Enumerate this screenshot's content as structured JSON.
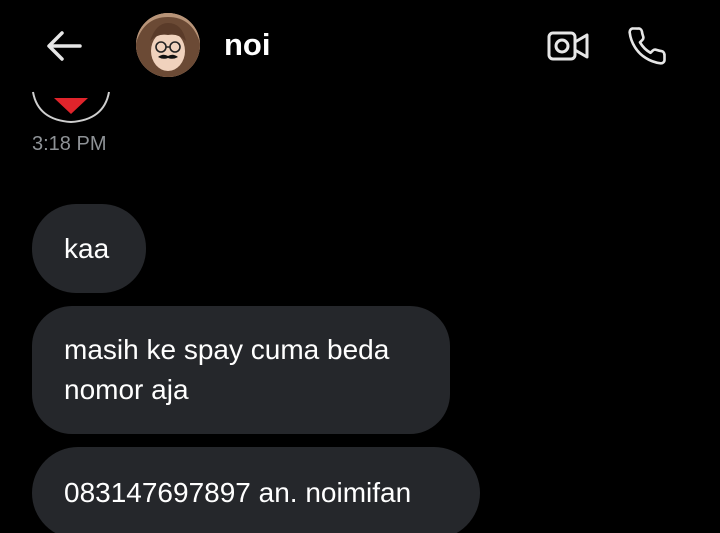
{
  "header": {
    "contact_name": "noi",
    "avatar_alt": "noi profile picture"
  },
  "icons": {
    "back": "arrow-left-icon",
    "video": "video-camera-icon",
    "call": "phone-icon",
    "previous": "heart-reaction-icon"
  },
  "conversation": {
    "timestamp": "3:18 PM",
    "messages": [
      {
        "text": "kaa"
      },
      {
        "text": "masih ke spay cuma beda nomor aja"
      },
      {
        "text": "083147697897 an. noimifan"
      }
    ]
  },
  "colors": {
    "background": "#000000",
    "bubble": "#25272b",
    "text": "#ffffff",
    "timestamp": "#8e9296",
    "icon": "#e6e6e6",
    "reaction": "#e0242b"
  }
}
